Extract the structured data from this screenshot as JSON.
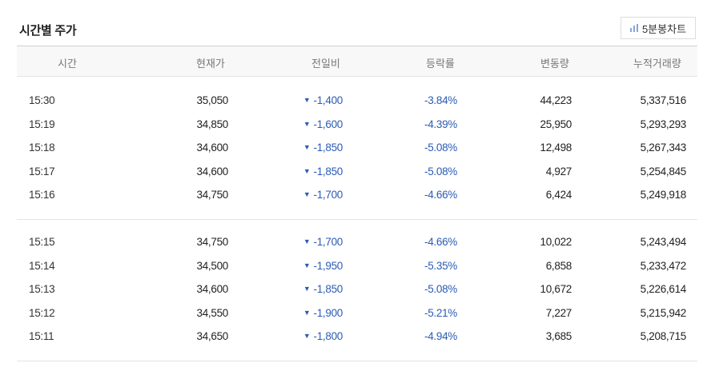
{
  "title": "시간별 주가",
  "chart_button": {
    "label": "5분봉차트",
    "icon": "bar-chart-icon"
  },
  "colors": {
    "down": "#2b5bb5",
    "text": "#222222",
    "header_bg": "#f8f8f8"
  },
  "columns": [
    "시간",
    "현재가",
    "전일비",
    "등락률",
    "변동량",
    "누적거래량"
  ],
  "groups": [
    {
      "rows": [
        {
          "time": "15:30",
          "price": "35,050",
          "change": "-1,400",
          "rate": "-3.84%",
          "volume": "44,223",
          "accum": "5,337,516"
        },
        {
          "time": "15:19",
          "price": "34,850",
          "change": "-1,600",
          "rate": "-4.39%",
          "volume": "25,950",
          "accum": "5,293,293"
        },
        {
          "time": "15:18",
          "price": "34,600",
          "change": "-1,850",
          "rate": "-5.08%",
          "volume": "12,498",
          "accum": "5,267,343"
        },
        {
          "time": "15:17",
          "price": "34,600",
          "change": "-1,850",
          "rate": "-5.08%",
          "volume": "4,927",
          "accum": "5,254,845"
        },
        {
          "time": "15:16",
          "price": "34,750",
          "change": "-1,700",
          "rate": "-4.66%",
          "volume": "6,424",
          "accum": "5,249,918"
        }
      ]
    },
    {
      "rows": [
        {
          "time": "15:15",
          "price": "34,750",
          "change": "-1,700",
          "rate": "-4.66%",
          "volume": "10,022",
          "accum": "5,243,494"
        },
        {
          "time": "15:14",
          "price": "34,500",
          "change": "-1,950",
          "rate": "-5.35%",
          "volume": "6,858",
          "accum": "5,233,472"
        },
        {
          "time": "15:13",
          "price": "34,600",
          "change": "-1,850",
          "rate": "-5.08%",
          "volume": "10,672",
          "accum": "5,226,614"
        },
        {
          "time": "15:12",
          "price": "34,550",
          "change": "-1,900",
          "rate": "-5.21%",
          "volume": "7,227",
          "accum": "5,215,942"
        },
        {
          "time": "15:11",
          "price": "34,650",
          "change": "-1,800",
          "rate": "-4.94%",
          "volume": "3,685",
          "accum": "5,208,715"
        }
      ]
    }
  ]
}
